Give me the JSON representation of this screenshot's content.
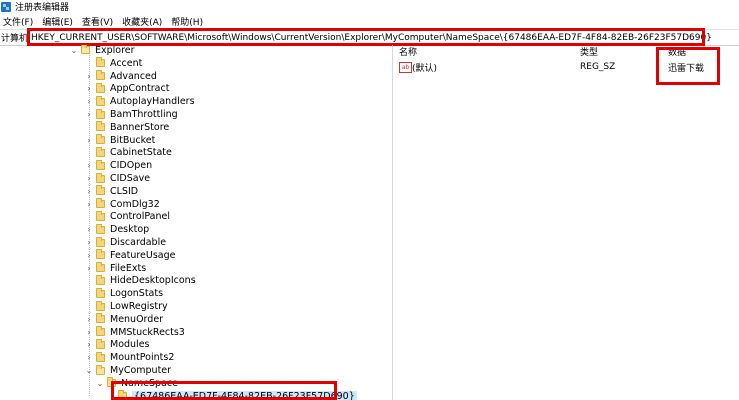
{
  "window": {
    "title": "注册表编辑器"
  },
  "menu": {
    "items": [
      "文件(F)",
      "编辑(E)",
      "查看(V)",
      "收藏夹(A)",
      "帮助(H)"
    ]
  },
  "address": {
    "label": "计算机",
    "path": "HKEY_CURRENT_USER\\SOFTWARE\\Microsoft\\Windows\\CurrentVersion\\Explorer\\MyComputer\\NameSpace\\{67486EAA-ED7F-4F84-82EB-26F23F57D690}"
  },
  "tree": {
    "parent": "Explorer",
    "items": [
      "Accent",
      "Advanced",
      "AppContract",
      "AutoplayHandlers",
      "BamThrottling",
      "BannerStore",
      "BitBucket",
      "CabinetState",
      "CIDOpen",
      "CIDSave",
      "CLSID",
      "ComDlg32",
      "ControlPanel",
      "Desktop",
      "Discardable",
      "FeatureUsage",
      "FileExts",
      "HideDesktopIcons",
      "LogonStats",
      "LowRegistry",
      "MenuOrder",
      "MMStuckRects3",
      "Modules",
      "MountPoints2"
    ],
    "mycomputer": "MyComputer",
    "namespace": "NameSpace",
    "selected": "{67486EAA-ED7F-4F84-82EB-26F23F57D690}"
  },
  "list": {
    "headers": {
      "name": "名称",
      "type": "类型",
      "data": "数据"
    },
    "rows": [
      {
        "icon": "string-value-icon",
        "name": "(默认)",
        "type": "REG_SZ",
        "data": "迅雷下载"
      }
    ]
  },
  "colors": {
    "highlight": "#e00000",
    "selection": "#cce8ff",
    "folder": "#f5d77a"
  }
}
